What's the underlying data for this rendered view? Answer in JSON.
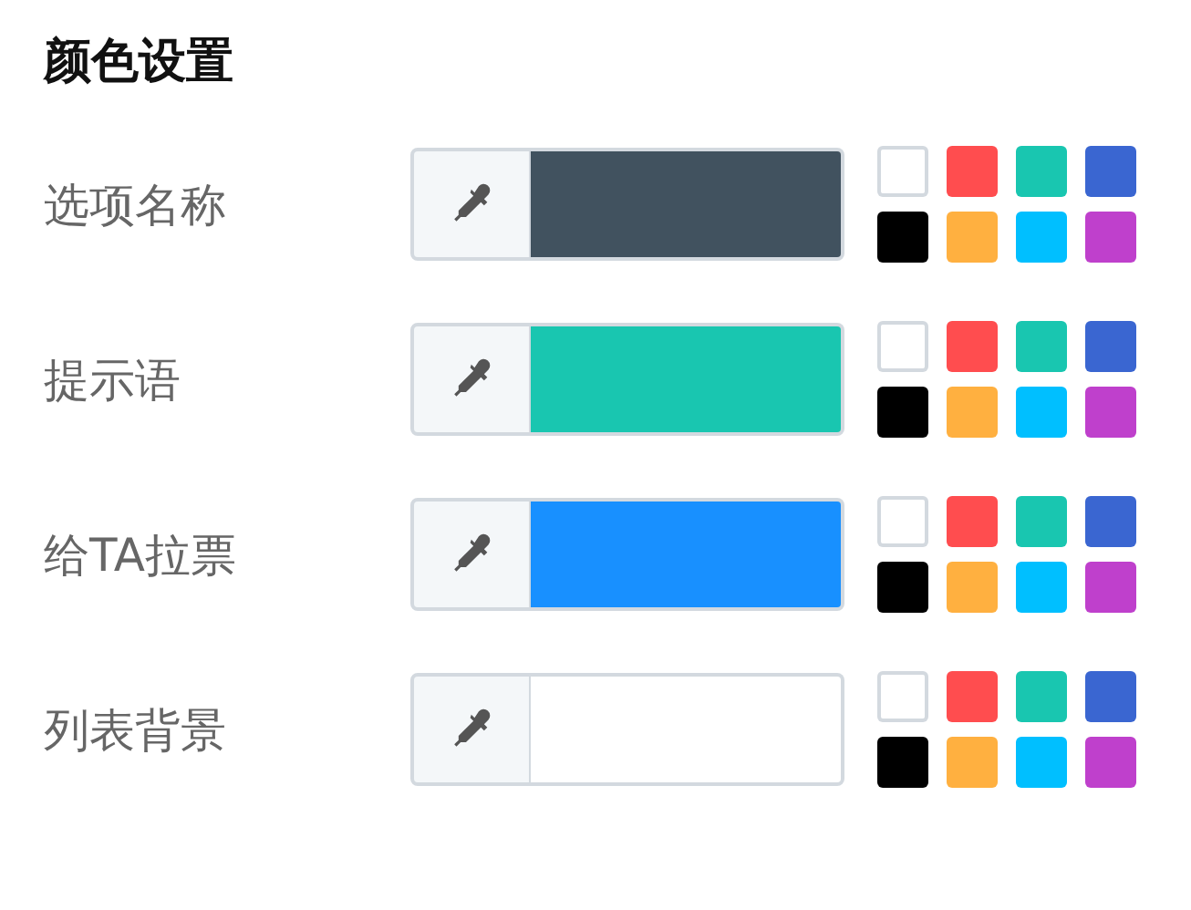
{
  "title": "颜色设置",
  "rows": [
    {
      "label": "选项名称",
      "color": "#41525f",
      "swatches": [
        {
          "color": "#ffffff"
        },
        {
          "color": "#ff4d4f"
        },
        {
          "color": "#19c6b0"
        },
        {
          "color": "#3a66d1"
        },
        {
          "color": "#000000"
        },
        {
          "color": "#ffb040"
        },
        {
          "color": "#00bfff"
        },
        {
          "color": "#bf40cc"
        }
      ]
    },
    {
      "label": "提示语",
      "color": "#19c6b0",
      "swatches": [
        {
          "color": "#ffffff"
        },
        {
          "color": "#ff4d4f"
        },
        {
          "color": "#19c6b0"
        },
        {
          "color": "#3a66d1"
        },
        {
          "color": "#000000"
        },
        {
          "color": "#ffb040"
        },
        {
          "color": "#00bfff"
        },
        {
          "color": "#bf40cc"
        }
      ]
    },
    {
      "label": "给TA拉票",
      "color": "#1890ff",
      "swatches": [
        {
          "color": "#ffffff"
        },
        {
          "color": "#ff4d4f"
        },
        {
          "color": "#19c6b0"
        },
        {
          "color": "#3a66d1"
        },
        {
          "color": "#000000"
        },
        {
          "color": "#ffb040"
        },
        {
          "color": "#00bfff"
        },
        {
          "color": "#bf40cc"
        }
      ]
    },
    {
      "label": "列表背景",
      "color": "#ffffff",
      "swatches": [
        {
          "color": "#ffffff"
        },
        {
          "color": "#ff4d4f"
        },
        {
          "color": "#19c6b0"
        },
        {
          "color": "#3a66d1"
        },
        {
          "color": "#000000"
        },
        {
          "color": "#ffb040"
        },
        {
          "color": "#00bfff"
        },
        {
          "color": "#bf40cc"
        }
      ]
    }
  ]
}
